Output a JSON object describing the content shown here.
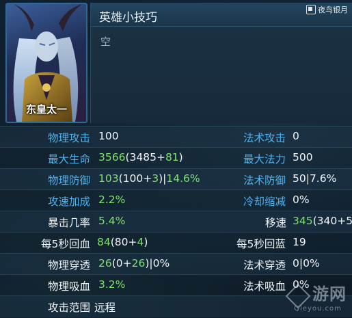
{
  "hero": {
    "name": "东皇太一"
  },
  "tips": {
    "title": "英雄小技巧",
    "content": "空"
  },
  "watermark_top": "夜鸟银月",
  "watermark_bottom": {
    "text": "游网",
    "sub": "Qieyou.com"
  },
  "stats": [
    {
      "left": {
        "label": "物理攻击",
        "color": "blue",
        "value": [
          {
            "t": "100",
            "c": "w"
          }
        ]
      },
      "right": {
        "label": "法术攻击",
        "color": "blue",
        "value": [
          {
            "t": "0",
            "c": "w"
          }
        ]
      }
    },
    {
      "left": {
        "label": "最大生命",
        "color": "blue",
        "value": [
          {
            "t": "3566",
            "c": "g"
          },
          {
            "t": "(3485+",
            "c": "w"
          },
          {
            "t": "81",
            "c": "g"
          },
          {
            "t": ")",
            "c": "w"
          }
        ]
      },
      "right": {
        "label": "最大法力",
        "color": "blue",
        "value": [
          {
            "t": "500",
            "c": "w"
          }
        ]
      }
    },
    {
      "left": {
        "label": "物理防御",
        "color": "blue",
        "value": [
          {
            "t": "103",
            "c": "g"
          },
          {
            "t": "(100+",
            "c": "w"
          },
          {
            "t": "3",
            "c": "g"
          },
          {
            "t": ")|",
            "c": "w"
          },
          {
            "t": "14.6%",
            "c": "g"
          }
        ]
      },
      "right": {
        "label": "法术防御",
        "color": "blue",
        "value": [
          {
            "t": "50|7.6%",
            "c": "w"
          }
        ]
      }
    },
    {
      "left": {
        "label": "攻速加成",
        "color": "blue",
        "value": [
          {
            "t": "2.2%",
            "c": "g"
          }
        ]
      },
      "right": {
        "label": "冷却缩减",
        "color": "blue",
        "value": [
          {
            "t": "0%",
            "c": "w"
          }
        ]
      }
    },
    {
      "left": {
        "label": "暴击几率",
        "color": "white",
        "value": [
          {
            "t": "5.4%",
            "c": "g"
          }
        ]
      },
      "right": {
        "label": "移速",
        "color": "white",
        "value": [
          {
            "t": "345",
            "c": "g"
          },
          {
            "t": "(340+5",
            "c": "w"
          }
        ]
      }
    },
    {
      "left": {
        "label": "每5秒回血",
        "color": "white",
        "value": [
          {
            "t": "84",
            "c": "g"
          },
          {
            "t": "(80+",
            "c": "w"
          },
          {
            "t": "4",
            "c": "g"
          },
          {
            "t": ")",
            "c": "w"
          }
        ]
      },
      "right": {
        "label": "每5秒回蓝",
        "color": "white",
        "value": [
          {
            "t": "19",
            "c": "w"
          }
        ]
      }
    },
    {
      "left": {
        "label": "物理穿透",
        "color": "white",
        "value": [
          {
            "t": "26",
            "c": "g"
          },
          {
            "t": "(0+",
            "c": "w"
          },
          {
            "t": "26",
            "c": "g"
          },
          {
            "t": ")|0%",
            "c": "w"
          }
        ]
      },
      "right": {
        "label": "法术穿透",
        "color": "white",
        "value": [
          {
            "t": "0|0%",
            "c": "w"
          }
        ]
      }
    },
    {
      "left": {
        "label": "物理吸血",
        "color": "white",
        "value": [
          {
            "t": "3.2%",
            "c": "g"
          }
        ]
      },
      "right": {
        "label": "法术吸血",
        "color": "white",
        "value": [
          {
            "t": "0%",
            "c": "w"
          }
        ]
      }
    },
    {
      "left": {
        "label": "攻击范围",
        "color": "white",
        "value": [
          {
            "t": "远程",
            "c": "w"
          }
        ]
      },
      "right": null
    }
  ]
}
